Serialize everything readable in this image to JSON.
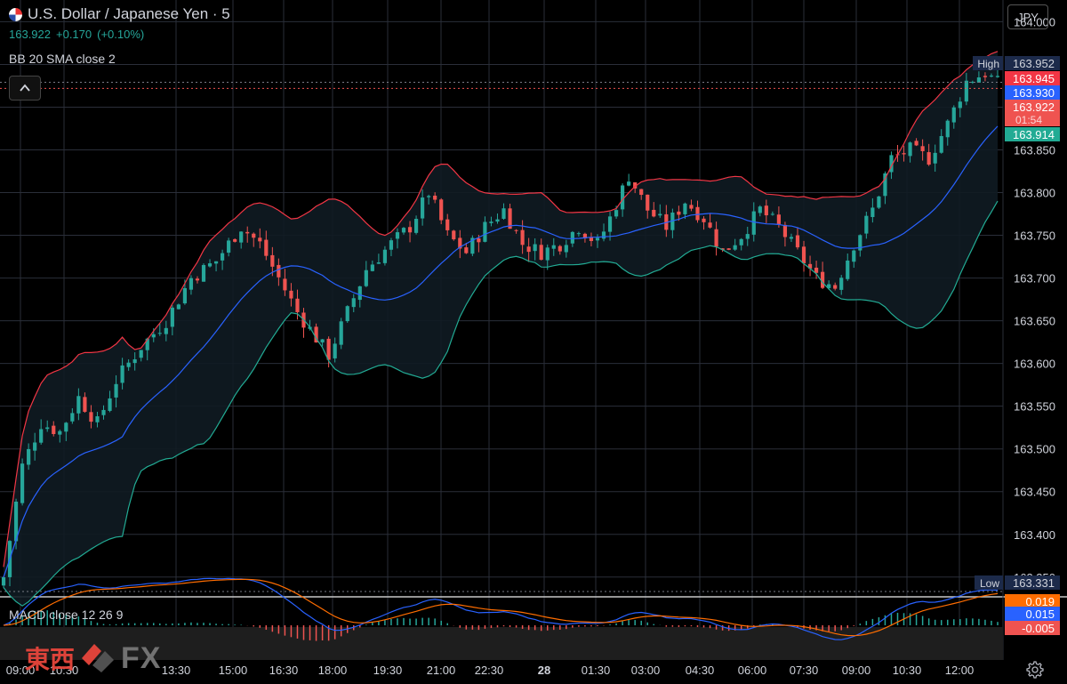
{
  "header": {
    "symbol_title": "U.S. Dollar / Japanese Yen · 5",
    "last_price": "163.922",
    "change": "+0.170",
    "change_pct": "(+0.10%)"
  },
  "indicators": {
    "bb_label": "BB 20 SMA close 2",
    "macd_label": "MACD close 12 26 9"
  },
  "toolbar": {
    "currency": "JPY"
  },
  "watermark": {
    "cn_text": "東西",
    "fx_text": "FX"
  },
  "colors": {
    "up": "#26a69a",
    "down": "#ef5350",
    "bb_upper": "#f23645",
    "bb_lower": "#22ab94",
    "bb_basis": "#2962ff",
    "macd": "#2962ff",
    "signal": "#ff6d00",
    "background": "#000000",
    "grid": "#2a2e39"
  },
  "chart_data": {
    "type": "candlestick",
    "x_ticks": [
      "09:00",
      "10:30",
      "13:30",
      "15:00",
      "16:30",
      "18:00",
      "19:30",
      "21:00",
      "22:30",
      "28",
      "01:30",
      "03:00",
      "04:30",
      "06:00",
      "07:30",
      "09:00",
      "10:30",
      "12:00"
    ],
    "y_ticks": [
      "164.000",
      "163.950",
      "163.900",
      "163.850",
      "163.800",
      "163.750",
      "163.700",
      "163.650",
      "163.600",
      "163.550",
      "163.500",
      "163.450",
      "163.400",
      "163.350"
    ],
    "ylim": [
      163.33,
      164.015
    ],
    "close_path": [
      [
        0,
        163.35
      ],
      [
        3,
        163.48
      ],
      [
        6,
        163.53
      ],
      [
        9,
        163.52
      ],
      [
        12,
        163.56
      ],
      [
        15,
        163.53
      ],
      [
        18,
        163.58
      ],
      [
        22,
        163.62
      ],
      [
        26,
        163.65
      ],
      [
        30,
        163.7
      ],
      [
        34,
        163.72
      ],
      [
        38,
        163.76
      ],
      [
        41,
        163.74
      ],
      [
        44,
        163.7
      ],
      [
        47,
        163.66
      ],
      [
        50,
        163.63
      ],
      [
        52,
        163.61
      ],
      [
        55,
        163.66
      ],
      [
        58,
        163.71
      ],
      [
        62,
        163.74
      ],
      [
        65,
        163.76
      ],
      [
        68,
        163.8
      ],
      [
        71,
        163.75
      ],
      [
        74,
        163.73
      ],
      [
        77,
        163.76
      ],
      [
        80,
        163.78
      ],
      [
        83,
        163.74
      ],
      [
        86,
        163.73
      ],
      [
        89,
        163.74
      ],
      [
        92,
        163.76
      ],
      [
        95,
        163.74
      ],
      [
        97,
        163.77
      ],
      [
        100,
        163.82
      ],
      [
        103,
        163.78
      ],
      [
        106,
        163.76
      ],
      [
        109,
        163.79
      ],
      [
        112,
        163.77
      ],
      [
        115,
        163.73
      ],
      [
        118,
        163.75
      ],
      [
        121,
        163.78
      ],
      [
        124,
        163.76
      ],
      [
        127,
        163.73
      ],
      [
        130,
        163.7
      ],
      [
        133,
        163.69
      ],
      [
        136,
        163.74
      ],
      [
        139,
        163.78
      ],
      [
        142,
        163.84
      ],
      [
        145,
        163.85
      ],
      [
        148,
        163.84
      ],
      [
        151,
        163.88
      ],
      [
        154,
        163.93
      ],
      [
        157,
        163.94
      ],
      [
        160,
        163.922
      ]
    ],
    "candles_visible": 160,
    "labels": {
      "high_label": "High",
      "high": "163.952",
      "bb_upper": "163.945",
      "bb_basis": "163.930",
      "last": "163.922",
      "countdown": "01:54",
      "bb_lower": "163.914",
      "low_label": "Low",
      "low": "163.331"
    },
    "macd_labels": {
      "signal": "0.019",
      "macd": "0.015",
      "hist": "-0.005"
    }
  }
}
